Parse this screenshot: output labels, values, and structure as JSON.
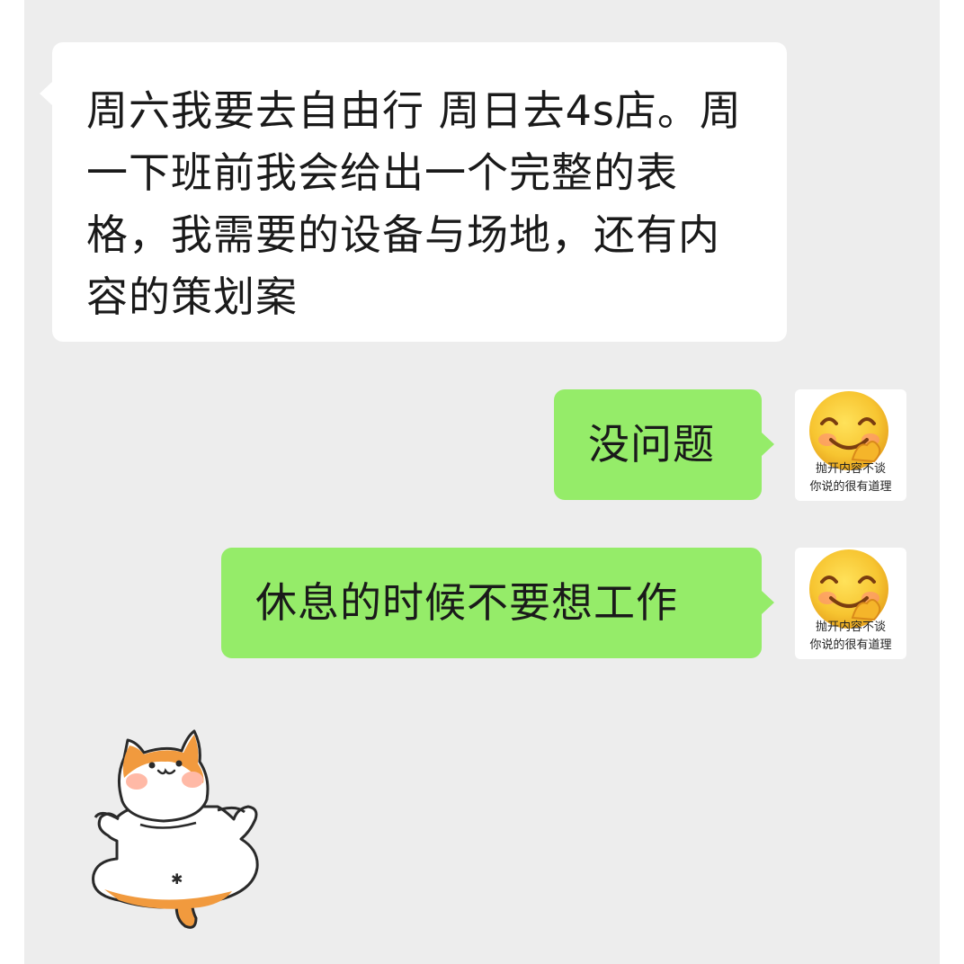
{
  "messages": [
    {
      "direction": "incoming",
      "text": "周六我要去自由行 周日去4s店。周一下班前我会给出一个完整的表格，我需要的设备与场地，还有内容的策划案"
    },
    {
      "direction": "outgoing",
      "text": "没问题"
    },
    {
      "direction": "outgoing",
      "text": "休息的时候不要想工作"
    }
  ],
  "avatar": {
    "icon": "blushing-smile-emoji",
    "caption_line1": "抛开内容不谈",
    "caption_line2": "你说的很有道理"
  },
  "sticker": {
    "icon": "shiba-dog-sticker"
  },
  "colors": {
    "chat_background": "#ededed",
    "incoming_bubble": "#ffffff",
    "outgoing_bubble": "#95ec69"
  }
}
